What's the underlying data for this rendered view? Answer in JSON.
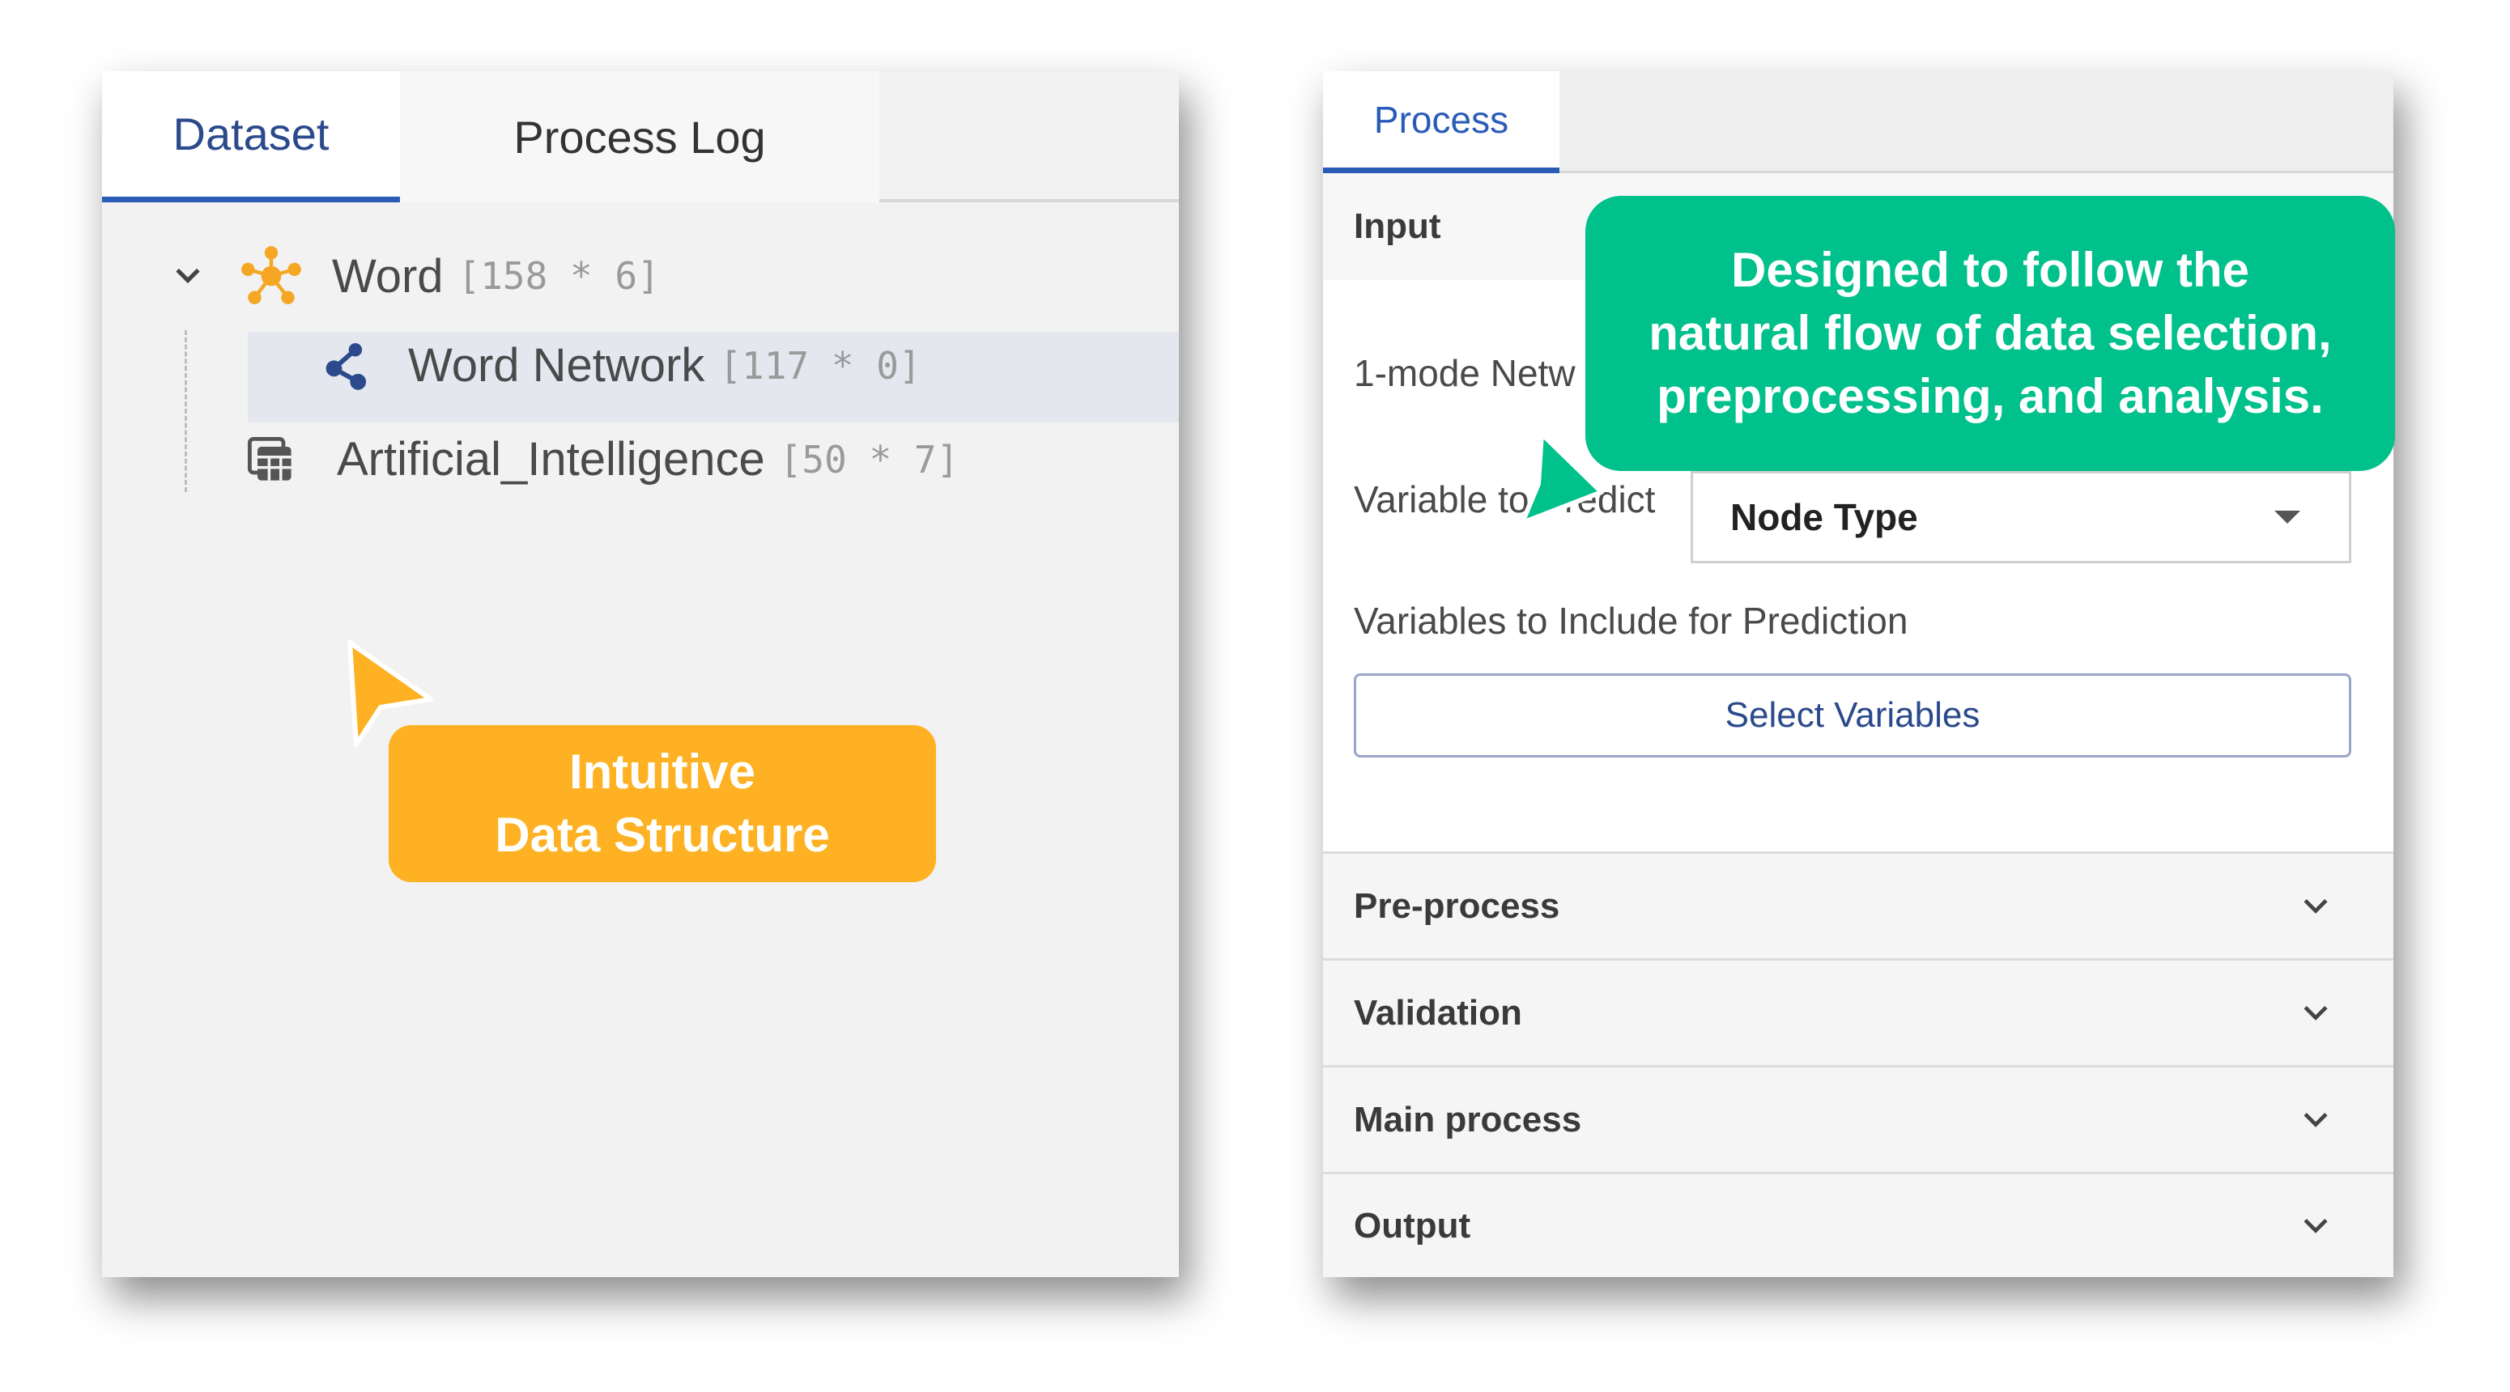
{
  "left_panel": {
    "tabs": [
      {
        "label": "Dataset",
        "active": true
      },
      {
        "label": "Process Log",
        "active": false
      }
    ],
    "tree": [
      {
        "name": "Word",
        "dims": "[158 * 6]",
        "icon": "network-node-icon",
        "expanded": true
      },
      {
        "name": "Word Network",
        "dims": "[117 * 0]",
        "icon": "network-graph-icon",
        "selected": true
      },
      {
        "name": "Artificial_Intelligence",
        "dims": "[50 * 7]",
        "icon": "table-icon"
      }
    ]
  },
  "right_panel": {
    "tab": "Process",
    "input": {
      "title": "Input",
      "network_label": "1-mode Netw",
      "variable_label": "Variable to Predict",
      "variable_value": "Node Type",
      "include_label": "Variables to Include for Prediction",
      "select_button": "Select Variables"
    },
    "sections": [
      "Pre-process",
      "Validation",
      "Main process",
      "Output"
    ]
  },
  "callouts": {
    "orange_lines": [
      "Intuitive",
      "Data Structure"
    ],
    "green_lines": [
      "Designed to follow the",
      "natural flow of data selection,",
      "preprocessing, and analysis."
    ]
  },
  "colors": {
    "accent_blue": "#2a5cb7",
    "callout_orange": "#fdb123",
    "callout_green": "#00c08b",
    "icon_orange": "#f5a623"
  }
}
